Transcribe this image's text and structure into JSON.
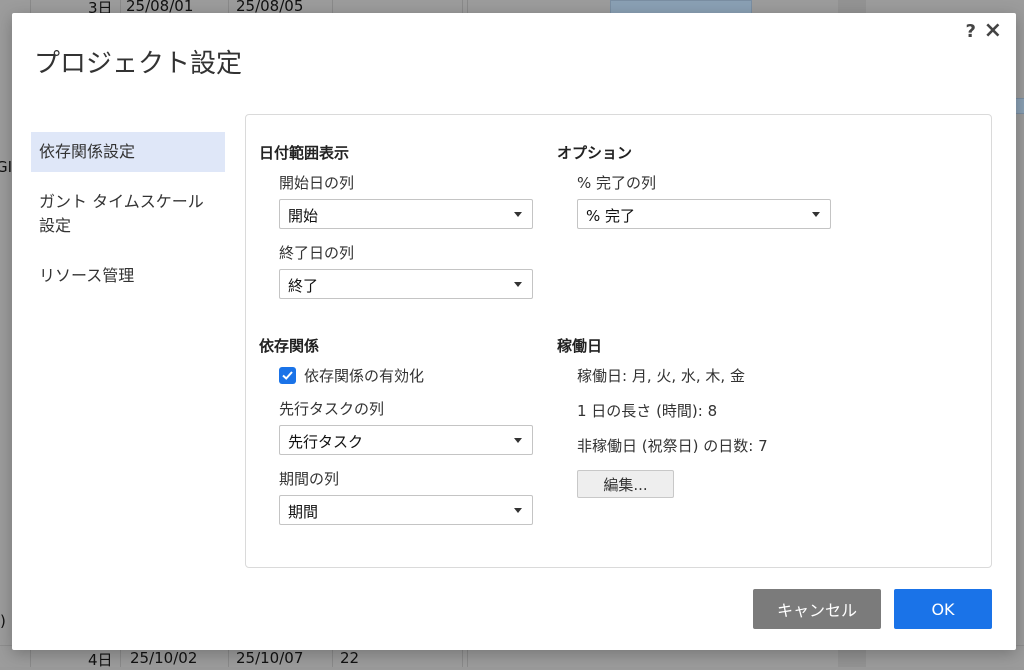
{
  "background": {
    "top_row": [
      "3日",
      "25/08/01",
      "25/08/05"
    ],
    "bottom_row": [
      "4日",
      "25/10/02",
      "25/10/07",
      "22"
    ],
    "left_fragments": [
      "GI",
      ")"
    ]
  },
  "dialog": {
    "title": "プロジェクト設定",
    "help": "?",
    "close": "×"
  },
  "nav": {
    "items": [
      {
        "label": "依存関係設定"
      },
      {
        "label": "ガント タイムスケール設定"
      },
      {
        "label": "リソース管理"
      }
    ]
  },
  "date_range": {
    "title": "日付範囲表示",
    "start_label": "開始日の列",
    "start_value": "開始",
    "end_label": "終了日の列",
    "end_value": "終了"
  },
  "options": {
    "title": "オプション",
    "percent_label": "% 完了の列",
    "percent_value": "% 完了"
  },
  "dependencies": {
    "title": "依存関係",
    "enable_label": "依存関係の有効化",
    "enabled": true,
    "predecessor_label": "先行タスクの列",
    "predecessor_value": "先行タスク",
    "duration_label": "期間の列",
    "duration_value": "期間"
  },
  "working_days": {
    "title": "稼働日",
    "days_line": "稼働日: 月, 火, 水, 木, 金",
    "length_line": "1 日の長さ (時間): 8",
    "holidays_line": "非稼働日 (祝祭日) の日数: 7",
    "edit_label": "編集..."
  },
  "footer": {
    "cancel_label": "キャンセル",
    "ok_label": "OK"
  },
  "colors": {
    "primary": "#1a73e8",
    "cancel": "#7b7b7b",
    "nav_active": "#dfe7f8"
  }
}
